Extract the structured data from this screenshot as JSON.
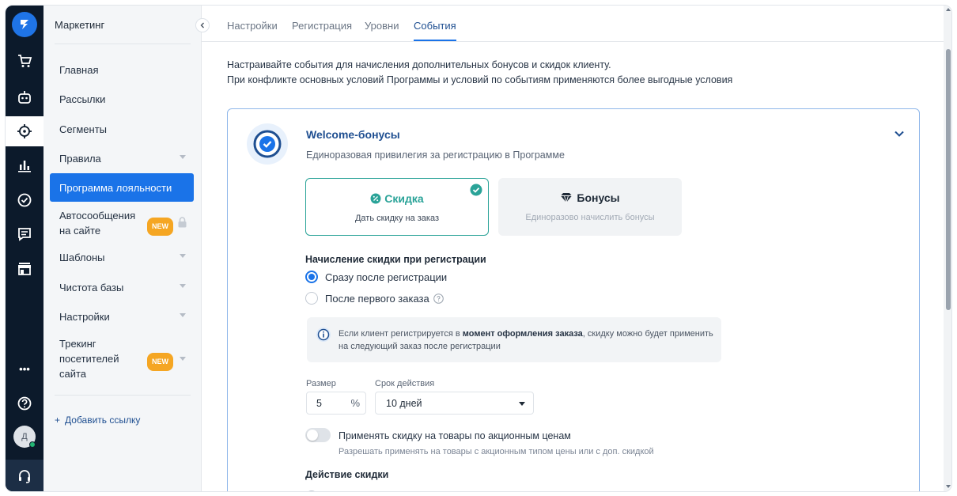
{
  "sidebar": {
    "title": "Маркетинг",
    "items": [
      {
        "label": "Главная"
      },
      {
        "label": "Рассылки"
      },
      {
        "label": "Сегменты"
      },
      {
        "label": "Правила"
      },
      {
        "label": "Программа лояльности"
      },
      {
        "label_line1": "Автосообщения",
        "label_line2": "на сайте",
        "badge": "NEW"
      },
      {
        "label": "Шаблоны"
      },
      {
        "label": "Чистота базы"
      },
      {
        "label": "Настройки"
      },
      {
        "label_line1": "Трекинг",
        "label_line2": "посетителей",
        "label_line3": "сайта",
        "badge": "NEW"
      }
    ],
    "add_link": "Добавить ссылку",
    "add_link_prefix": "+"
  },
  "rail": {
    "avatar_letter": "Д",
    "more_label": "•••"
  },
  "tabs": [
    {
      "label": "Настройки"
    },
    {
      "label": "Регистрация"
    },
    {
      "label": "Уровни"
    },
    {
      "label": "События"
    }
  ],
  "intro": {
    "line1": "Настраивайте события для начисления дополнительных бонусов и скидок клиенту.",
    "line2": "При конфликте основных условий Программы и условий по событиям применяются более выгодные условия"
  },
  "card": {
    "title": "Welcome-бонусы",
    "subtitle": "Единоразовая привилегия за регистрацию в Программе",
    "option_discount": {
      "title": "Скидка",
      "subtitle": "Дать скидку на заказ"
    },
    "option_bonus": {
      "title": "Бонусы",
      "subtitle": "Единоразово начислить бонусы"
    },
    "accrual_heading": "Начисление скидки при регистрации",
    "radio_after_registration": "Сразу после регистрации",
    "radio_after_first_order": "После первого заказа",
    "info_pre": "Если клиент регистрируется в ",
    "info_bold": "момент оформления заказа",
    "info_post": ", скидку можно будет применить на следующий заказ после регистрации",
    "size_label": "Размер",
    "size_value": "5",
    "size_unit": "%",
    "validity_label": "Срок действия",
    "validity_value": "10 дней",
    "switch_label": "Применять скидку на товары по акционным ценам",
    "switch_sub": "Разрешать применять на товары с акционным типом цены или с доп. скидкой",
    "action_heading": "Действие скидки"
  },
  "colors": {
    "accent": "#1a73e8",
    "teal": "#2aa398",
    "rail": "#0c1a2b",
    "badge": "#f5a623"
  }
}
